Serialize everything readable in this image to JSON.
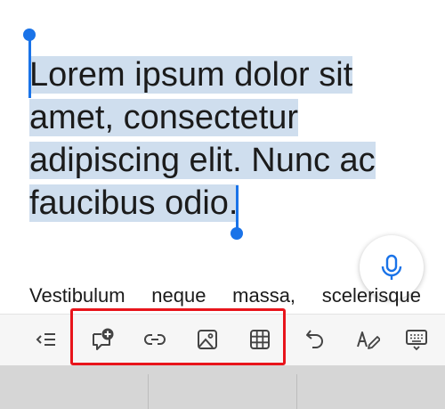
{
  "document": {
    "selected_paragraph": "Lorem ipsum dolor sit amet, consectetur adipiscing elit. Nunc ac faucibus odio.",
    "line1": "Lorem ipsum dolor sit",
    "line2": "amet, consectetur",
    "line3": "adipiscing elit. Nunc ac",
    "line4": "faucibus odio.",
    "next_paragraph": "Vestibulum neque massa, scelerisque"
  },
  "toolbar": {
    "items": [
      {
        "name": "outdent",
        "icon": "outdent-icon"
      },
      {
        "name": "new-comment",
        "icon": "comment-add-icon"
      },
      {
        "name": "link",
        "icon": "link-icon"
      },
      {
        "name": "picture",
        "icon": "image-icon"
      },
      {
        "name": "table",
        "icon": "table-icon"
      },
      {
        "name": "undo",
        "icon": "undo-icon"
      },
      {
        "name": "draw",
        "icon": "draw-pen-icon"
      },
      {
        "name": "keyboard",
        "icon": "keyboard-icon"
      }
    ],
    "highlighted_group": [
      "new-comment",
      "link",
      "picture",
      "table"
    ]
  },
  "dictate_button": {
    "icon": "microphone-icon"
  },
  "colors": {
    "selection": "#cfdeee",
    "handle": "#1a73e8",
    "highlight_box": "#e8141b",
    "toolbar_bg": "#f6f6f6",
    "keyboard_bg": "#d6d6d6"
  }
}
